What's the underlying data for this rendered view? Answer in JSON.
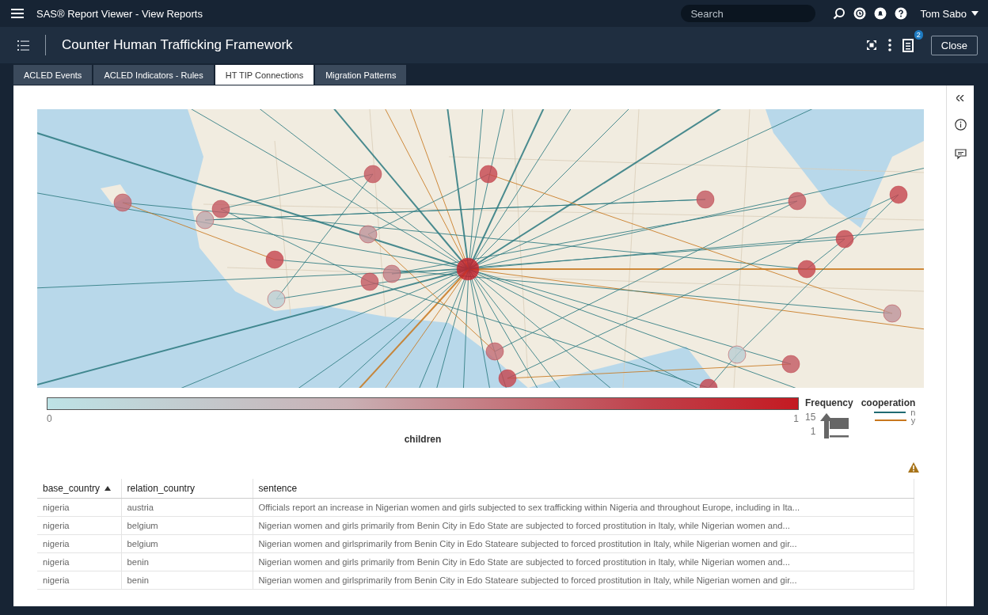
{
  "app_bar": {
    "title": "SAS® Report Viewer - View Reports",
    "search": {
      "placeholder": "Search"
    },
    "user": "Tom Sabo"
  },
  "report_bar": {
    "title": "Counter Human Trafficking Framework",
    "notification_count": "2",
    "close_button": "Close"
  },
  "tabs": [
    {
      "label": "ACLED Events",
      "selected": false
    },
    {
      "label": "ACLED Indicators - Rules",
      "selected": false
    },
    {
      "label": "HT TIP Connections",
      "selected": true
    },
    {
      "label": "Migration Patterns",
      "selected": false
    }
  ],
  "legend": {
    "color_scale": {
      "min": "0",
      "max": "1",
      "title": "children"
    },
    "frequency": {
      "title": "Frequency",
      "max": "15",
      "min": "1"
    },
    "cooperation": {
      "title": "cooperation",
      "items": [
        {
          "label": "n",
          "color": "#1f6b72"
        },
        {
          "label": "y",
          "color": "#c8781e"
        }
      ]
    }
  },
  "table": {
    "columns": [
      {
        "label": "base_country",
        "sorted": true
      },
      {
        "label": "relation_country",
        "sorted": false
      },
      {
        "label": "sentence",
        "sorted": false
      }
    ],
    "rows": [
      [
        "nigeria",
        "austria",
        "Officials report an increase in Nigerian women and girls subjected to sex trafficking within Nigeria and throughout Europe, including in Ita..."
      ],
      [
        "nigeria",
        "belgium",
        "Nigerian women and girls  primarily from Benin City in Edo State  are subjected to forced prostitution in Italy, while Nigerian women and..."
      ],
      [
        "nigeria",
        "belgium",
        "Nigerian women and girlsprimarily from Benin City in Edo Stateare subjected to forced prostitution in Italy, while Nigerian women and gir..."
      ],
      [
        "nigeria",
        "benin",
        "Nigerian women and girls  primarily from Benin City in Edo State  are subjected to forced prostitution in Italy, while Nigerian women and..."
      ],
      [
        "nigeria",
        "benin",
        "Nigerian women and girlsprimarily from Benin City in Edo Stateare subjected to forced prostitution in Italy, while Nigerian women and gir..."
      ]
    ]
  }
}
